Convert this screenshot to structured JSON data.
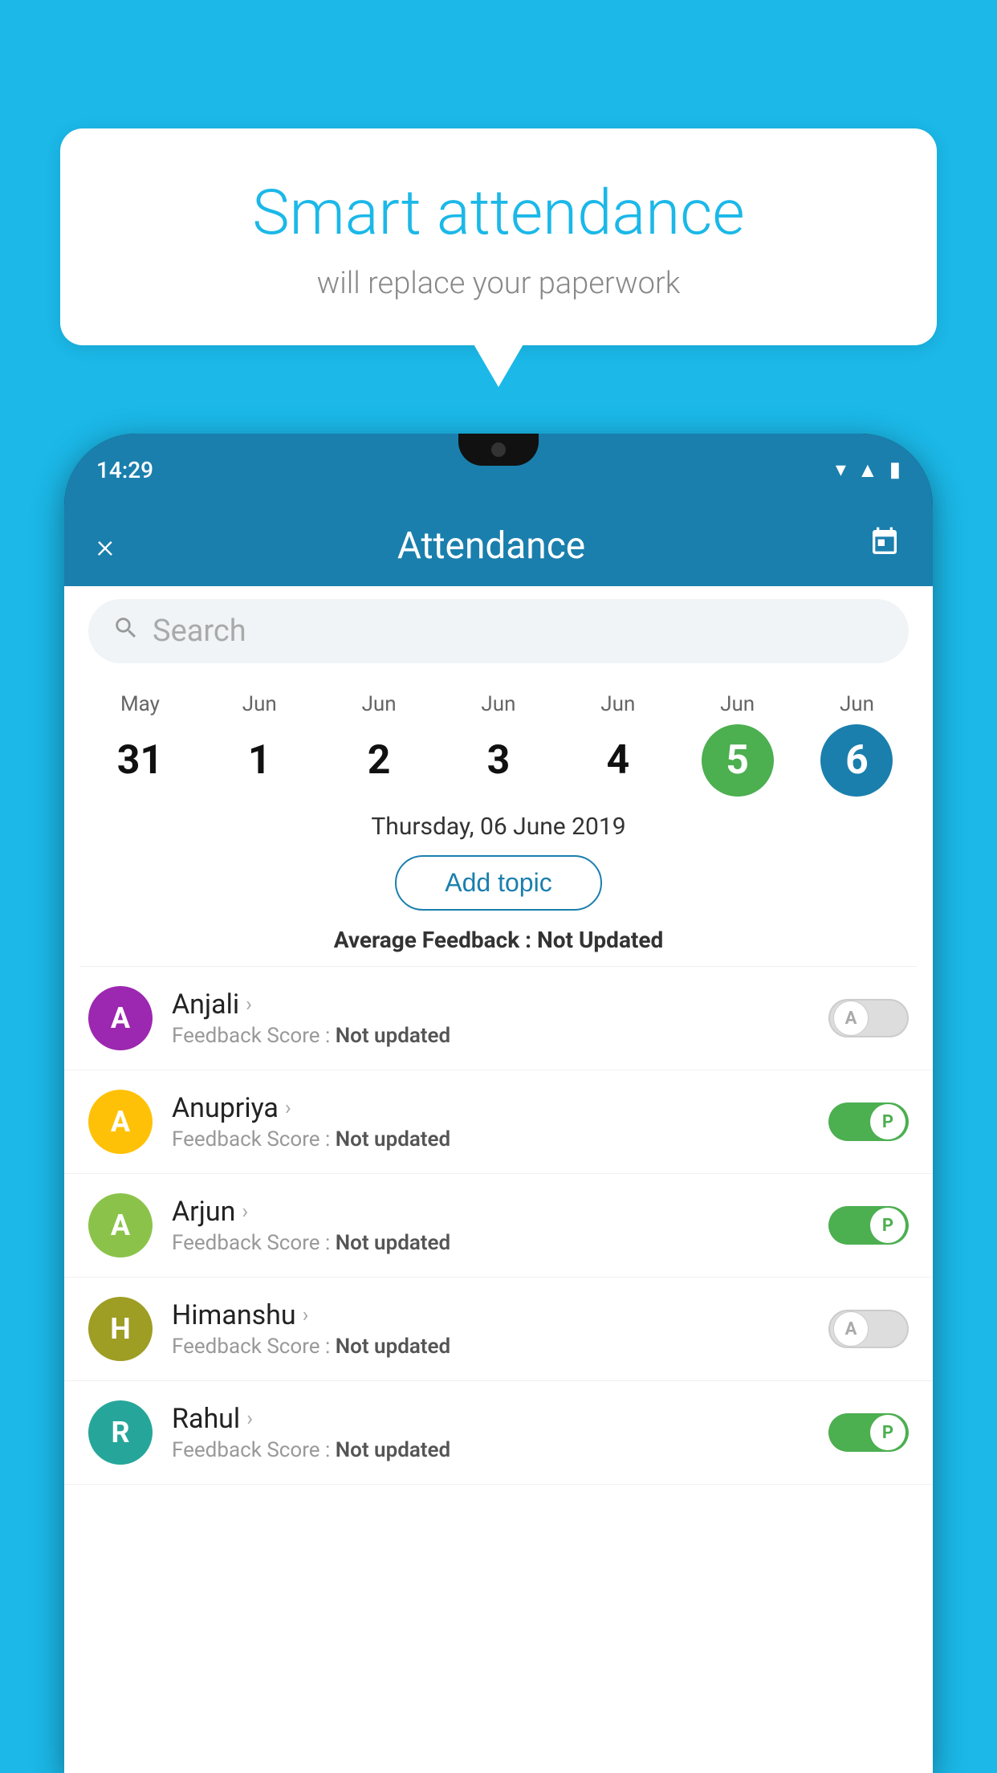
{
  "background_color": "#1BB8E8",
  "bubble": {
    "title": "Smart attendance",
    "subtitle": "will replace your paperwork"
  },
  "phone": {
    "status_bar": {
      "time": "14:29",
      "icons": [
        "wifi",
        "signal",
        "battery"
      ]
    },
    "header": {
      "close_label": "×",
      "title": "Attendance",
      "calendar_icon": "📅"
    },
    "search": {
      "placeholder": "Search"
    },
    "calendar": {
      "days": [
        {
          "month": "May",
          "date": "31",
          "style": "normal"
        },
        {
          "month": "Jun",
          "date": "1",
          "style": "normal"
        },
        {
          "month": "Jun",
          "date": "2",
          "style": "normal"
        },
        {
          "month": "Jun",
          "date": "3",
          "style": "normal"
        },
        {
          "month": "Jun",
          "date": "4",
          "style": "normal"
        },
        {
          "month": "Jun",
          "date": "5",
          "style": "today"
        },
        {
          "month": "Jun",
          "date": "6",
          "style": "selected"
        }
      ]
    },
    "selected_date_label": "Thursday, 06 June 2019",
    "add_topic_label": "Add topic",
    "avg_feedback_prefix": "Average Feedback : ",
    "avg_feedback_value": "Not Updated",
    "students": [
      {
        "name": "Anjali",
        "avatar_letter": "A",
        "avatar_color": "purple",
        "feedback": "Feedback Score : ",
        "feedback_value": "Not updated",
        "toggle_state": "off",
        "toggle_letter": "A"
      },
      {
        "name": "Anupriya",
        "avatar_letter": "A",
        "avatar_color": "yellow",
        "feedback": "Feedback Score : ",
        "feedback_value": "Not updated",
        "toggle_state": "on",
        "toggle_letter": "P"
      },
      {
        "name": "Arjun",
        "avatar_letter": "A",
        "avatar_color": "light-green",
        "feedback": "Feedback Score : ",
        "feedback_value": "Not updated",
        "toggle_state": "on",
        "toggle_letter": "P"
      },
      {
        "name": "Himanshu",
        "avatar_letter": "H",
        "avatar_color": "olive",
        "feedback": "Feedback Score : ",
        "feedback_value": "Not updated",
        "toggle_state": "off",
        "toggle_letter": "A"
      },
      {
        "name": "Rahul",
        "avatar_letter": "R",
        "avatar_color": "teal",
        "feedback": "Feedback Score : ",
        "feedback_value": "Not updated",
        "toggle_state": "on",
        "toggle_letter": "P"
      }
    ]
  }
}
